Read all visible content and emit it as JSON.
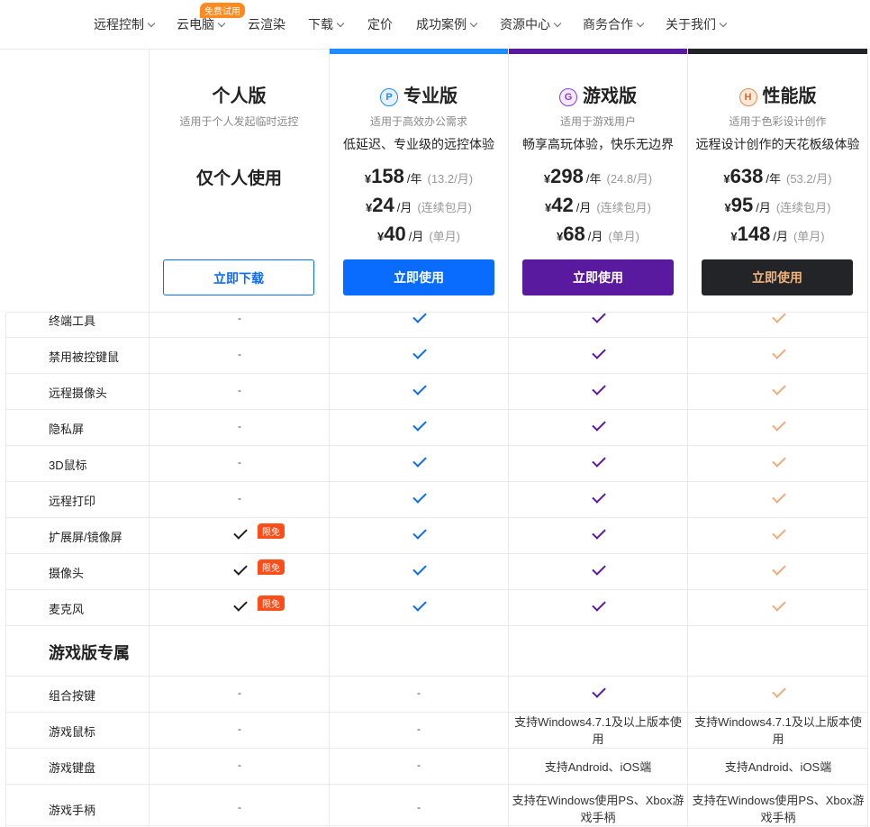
{
  "nav": {
    "items": [
      "远程控制",
      "云电脑",
      "云渲染",
      "下载",
      "定价",
      "成功案例",
      "资源中心",
      "商务合作",
      "关于我们"
    ],
    "badge": "免费试用"
  },
  "plans": [
    {
      "name": "个人版",
      "sub": "适用于个人发起临时远控",
      "only": "仅个人使用",
      "button": "立即下载"
    },
    {
      "icon": "P",
      "name": "专业版",
      "sub": "适用于高效办公需求",
      "tag": "低延迟、专业级的远控体验",
      "prices": [
        {
          "amt": "158",
          "unit": "/年",
          "note": "(13.2/月)"
        },
        {
          "amt": "24",
          "unit": "/月",
          "note": "(连续包月)"
        },
        {
          "amt": "40",
          "unit": "/月",
          "note": "(单月)"
        }
      ],
      "button": "立即使用"
    },
    {
      "icon": "G",
      "name": "游戏版",
      "sub": "适用于游戏用户",
      "tag": "畅享高玩体验，快乐无边界",
      "prices": [
        {
          "amt": "298",
          "unit": "/年",
          "note": "(24.8/月)"
        },
        {
          "amt": "42",
          "unit": "/月",
          "note": "(连续包月)"
        },
        {
          "amt": "68",
          "unit": "/月",
          "note": "(单月)"
        }
      ],
      "button": "立即使用"
    },
    {
      "icon": "H",
      "name": "性能版",
      "sub": "适用于色彩设计创作",
      "tag": "远程设计创作的天花板级体验",
      "prices": [
        {
          "amt": "638",
          "unit": "/年",
          "note": "(53.2/月)"
        },
        {
          "amt": "95",
          "unit": "/月",
          "note": "(连续包月)"
        },
        {
          "amt": "148",
          "unit": "/月",
          "note": "(单月)"
        }
      ],
      "button": "立即使用"
    }
  ],
  "currency": "¥",
  "colors": {
    "pro": "#0a6cff",
    "game": "#5a1aa0",
    "perf": "#222428",
    "perf_text": "#f4b27a",
    "perf_check": "#f4a97a",
    "free_badge": "#ff4d1a"
  },
  "features": [
    {
      "label": "终端工具",
      "c": [
        "-",
        "check",
        "check",
        "check"
      ]
    },
    {
      "label": "禁用被控键鼠",
      "c": [
        "-",
        "check",
        "check",
        "check"
      ]
    },
    {
      "label": "远程摄像头",
      "c": [
        "-",
        "check",
        "check",
        "check"
      ]
    },
    {
      "label": "隐私屏",
      "c": [
        "-",
        "check",
        "check",
        "check"
      ]
    },
    {
      "label": "3D鼠标",
      "c": [
        "-",
        "check",
        "check",
        "check"
      ]
    },
    {
      "label": "远程打印",
      "c": [
        "-",
        "check",
        "check",
        "check"
      ]
    },
    {
      "label": "扩展屏/镜像屏",
      "c": [
        "checkfree",
        "check",
        "check",
        "check"
      ]
    },
    {
      "label": "摄像头",
      "c": [
        "checkfree",
        "check",
        "check",
        "check"
      ]
    },
    {
      "label": "麦克风",
      "c": [
        "checkfree",
        "check",
        "check",
        "check"
      ]
    }
  ],
  "free_label": "限免",
  "section": "游戏版专属",
  "game_features": [
    {
      "label": "组合按键",
      "c": [
        "-",
        "-",
        "check",
        "check"
      ]
    },
    {
      "label": "游戏鼠标",
      "c": [
        "-",
        "-",
        "支持Windows4.7.1及以上版本使用",
        "支持Windows4.7.1及以上版本使用"
      ]
    },
    {
      "label": "游戏键盘",
      "c": [
        "-",
        "-",
        "支持Android、iOS端",
        "支持Android、iOS端"
      ]
    },
    {
      "label": "游戏手柄",
      "c": [
        "-",
        "-",
        "支持在Windows使用PS、Xbox游戏手柄",
        "支持在Windows使用PS、Xbox游戏手柄"
      ]
    }
  ]
}
